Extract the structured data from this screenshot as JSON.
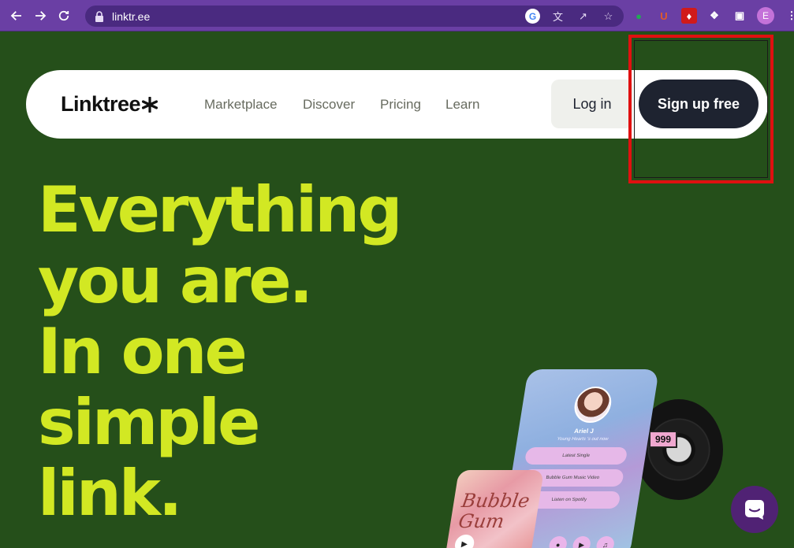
{
  "browser": {
    "url": "linktr.ee",
    "omnibox_icons": [
      "google-lens-icon",
      "translate-icon",
      "share-icon",
      "bookmark-star-icon"
    ],
    "extensions": [
      {
        "name": "color-extension-icon",
        "glyph": "●",
        "color": "#22aa55"
      },
      {
        "name": "ublock-icon",
        "glyph": "U",
        "color": "#e05a2a"
      },
      {
        "name": "acrobat-icon",
        "glyph": "♦",
        "color": "#d11a1a"
      },
      {
        "name": "extensions-puzzle-icon",
        "glyph": "❖",
        "color": "#ffffff"
      },
      {
        "name": "side-panel-icon",
        "glyph": "▣",
        "color": "#ffffff"
      }
    ],
    "profile_initial": "E"
  },
  "nav": {
    "logo_text": "Linktree",
    "links": [
      "Marketplace",
      "Discover",
      "Pricing",
      "Learn"
    ],
    "login_label": "Log in",
    "signup_label": "Sign up free"
  },
  "hero": {
    "lines": [
      "Everything",
      "you are.",
      "In one",
      "simple",
      "link."
    ]
  },
  "mockup": {
    "profile_name": "Ariel J",
    "profile_sub": "Young Hearts ‘s out now",
    "links": [
      "Latest Single",
      "Bubble Gum Music Video",
      "Listen on Spotify"
    ],
    "record_label": "999",
    "card_title": "Bubble Gum"
  },
  "colors": {
    "page_background": "#254f1a",
    "hero_text": "#d2e823",
    "signup_button": "#1e2330",
    "chat_button": "#502274",
    "annotation": "#e01010"
  }
}
